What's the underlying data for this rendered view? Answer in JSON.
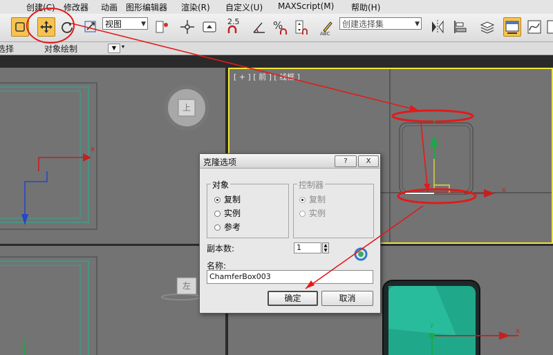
{
  "menubar": {
    "items": [
      "创建(C)",
      "修改器",
      "动画",
      "图形编辑器",
      "渲染(R)",
      "自定义(U)",
      "MAXScript(M)",
      "帮助(H)"
    ]
  },
  "toolbar": {
    "viewport_combo": "视图",
    "angle_snap_value": "2.5",
    "selection_set_placeholder": "创建选择集"
  },
  "ribbon": {
    "left_label": "选择",
    "object_paint_label": "对象绘制"
  },
  "viewports": {
    "front_label": "[ + ] [ 前 ] [ 线框 ]",
    "top_viewcube_label": "上",
    "left_viewcube_label": "左",
    "axis_x": "x",
    "axis_y": "y"
  },
  "dialog": {
    "title": "克隆选项",
    "help_button": "?",
    "close_button": "X",
    "object_group": {
      "label": "对象",
      "options": [
        "复制",
        "实例",
        "参考"
      ],
      "selected": "复制"
    },
    "controller_group": {
      "label": "控制器",
      "options": [
        "复制",
        "实例"
      ],
      "selected": "复制",
      "disabled": true
    },
    "copies_label": "副本数:",
    "copies_value": "1",
    "name_label": "名称:",
    "name_value": "ChamferBox003",
    "ok_button": "确定",
    "cancel_button": "取消"
  },
  "colors": {
    "active_border": "#f1e73a",
    "annotation_red": "#e21a1a",
    "viewport_bg": "#737373",
    "green_object": "#1fa88a"
  }
}
